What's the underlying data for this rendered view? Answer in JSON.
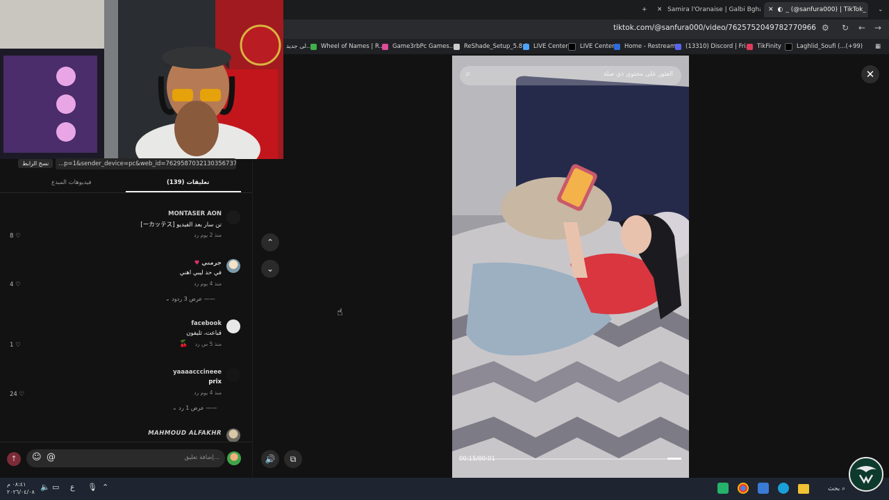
{
  "browser": {
    "tabs": [
      {
        "label": "Samira l'Oranaise | Galbi Bgha"
      },
      {
        "label": "_ (@sanfura000) | TikTok_"
      }
    ],
    "url": "tiktok.com/@sanfura000/video/7625752049782770966",
    "bookmarks": [
      {
        "label": "Wheel of Names | R..."
      },
      {
        "label": "Game3rbPc Games..."
      },
      {
        "label": "ReShade_Setup_5.8.0"
      },
      {
        "label": "LIVE Center"
      },
      {
        "label": "LIVE Center"
      },
      {
        "label": "Home - Restream"
      },
      {
        "label": "(13310) Discord | Fri..."
      },
      {
        "label": "TikFinity"
      },
      {
        "label": "Laghlid_Soufi (...(+99)"
      }
    ],
    "bookmark_partial": "لى جديد..."
  },
  "share": {
    "copy_label": "نسخ الرابط",
    "link_text": "...p=1&sender_device=pc&web_id=7629587032130356737"
  },
  "panel_tabs": {
    "comments_label": "تعليقات (139)",
    "creator_videos_label": "فيديوهات المبدع"
  },
  "comments": [
    {
      "user": "MONTASER AON",
      "text": "[ーカッテス] تن سار بعد الفيديو",
      "meta": "منذ 2 يوم   رد",
      "likes": "8"
    },
    {
      "user": "جرمني",
      "text": "في حد ليبي اهني",
      "meta": "منذ 4 يوم   رد",
      "likes": "4",
      "replies": "عرض 3 ردود"
    },
    {
      "user": "facebook",
      "text": "قباعت، ثليفون",
      "meta": "منذ 5 س   رد",
      "likes": "1"
    },
    {
      "user": "yaaaacccineee",
      "text": "prix",
      "meta": "منذ 4 يوم   رد",
      "likes": "24",
      "replies": "عرض 1 رد"
    },
    {
      "user": "MAHMOUD ALFAKHR",
      "text": "",
      "meta": "",
      "likes": ""
    }
  ],
  "input": {
    "placeholder": "إضافة تعليق..."
  },
  "video": {
    "search_placeholder": "العثور على محتوى ذي صلة",
    "timecode": "00:15/00:01",
    "progress": 0.94
  },
  "taskbar": {
    "time": "٠٨:٤١ م",
    "date": "٢٠٢٦/٠٤/٠٨",
    "search_label": "بحث",
    "lang": "ع"
  },
  "colors": {
    "accent_send": "#7a2b36",
    "tiktok_dark": "#121212"
  }
}
